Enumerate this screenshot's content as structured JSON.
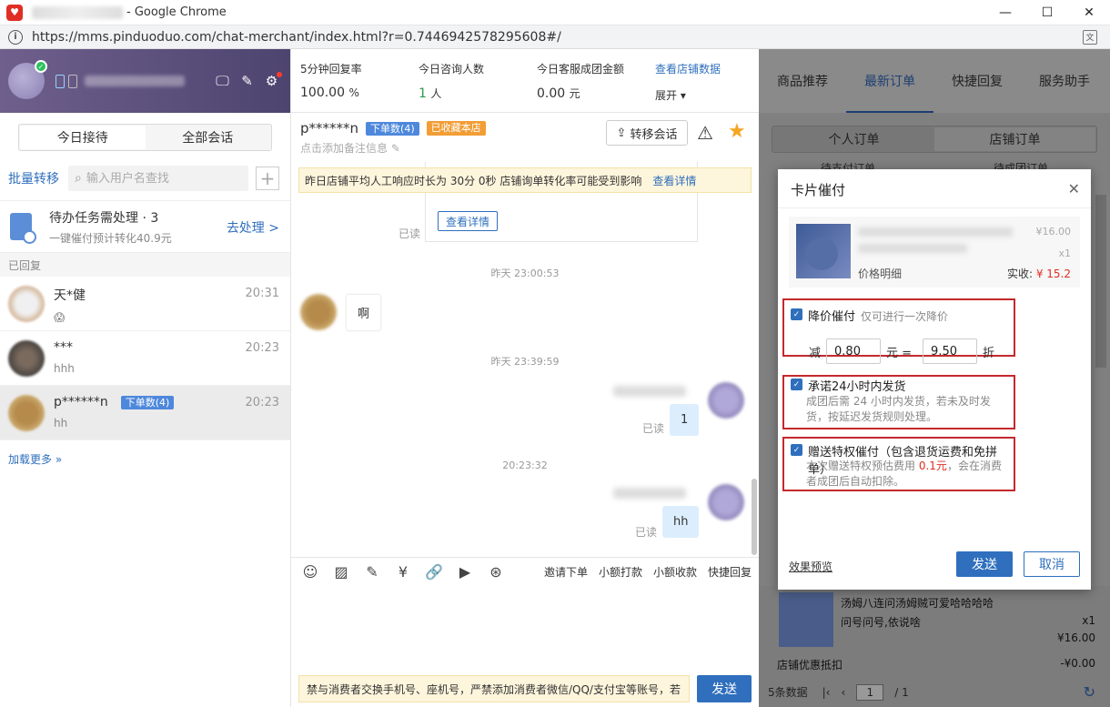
{
  "window": {
    "title": "- Google Chrome",
    "url": "https://mms.pinduoduo.com/chat-merchant/index.html?r=0.7446942578295608#/"
  },
  "sidebar": {
    "tabs": [
      "今日接待",
      "全部会话"
    ],
    "batch_transfer": "批量转移",
    "search_placeholder": "输入用户名查找",
    "todo": {
      "title": "待办任务需处理 · 3",
      "sub": "一键催付预计转化40.9元",
      "action": "去处理 >"
    },
    "section_label": "已回复",
    "conversations": [
      {
        "name": "天*健",
        "sub": "😱",
        "time": "20:31",
        "badge": ""
      },
      {
        "name": "***",
        "sub": "hhh",
        "time": "20:23",
        "badge": ""
      },
      {
        "name": "p******n",
        "sub": "hh",
        "time": "20:23",
        "badge": "下单数(4)"
      }
    ],
    "load_more": "加载更多 »"
  },
  "stats": [
    {
      "label": "5分钟回复率",
      "value": "100.00",
      "unit": "%"
    },
    {
      "label": "今日咨询人数",
      "value": "1",
      "unit": "人"
    },
    {
      "label": "今日客服成团金额",
      "value": "0.00",
      "unit": "元"
    }
  ],
  "stats_links": {
    "view": "查看店铺数据",
    "expand": "展开 ▾"
  },
  "chat": {
    "customer": "p******n",
    "badge_orders": "下单数(4)",
    "badge_fav": "已收藏本店",
    "note": "点击添加备注信息",
    "transfer": "转移会话",
    "notice": "昨日店铺平均人工响应时长为 30分 0秒 店铺询单转化率可能受到影响",
    "notice_link": "查看详情",
    "card_detail": "查看详情",
    "read": "已读",
    "ts1": "昨天 23:00:53",
    "msg1": "啊",
    "ts2": "昨天 23:39:59",
    "msg2": "1",
    "ts3": "20:23:32",
    "msg3": "hh",
    "toolbar_text": [
      "邀请下单",
      "小额打款",
      "小额收款",
      "快捷回复"
    ],
    "input_warning": "禁与消费者交换手机号、座机号，严禁添加消费者微信/QQ/支付宝等账号，若",
    "send": "发送"
  },
  "right": {
    "tabs": [
      "商品推荐",
      "最新订单",
      "快捷回复",
      "服务助手"
    ],
    "subseg": [
      "个人订单",
      "店铺订单"
    ],
    "sub2": [
      "待支付订单",
      "待成团订单"
    ],
    "under": {
      "t1": "汤姆八连问汤姆贼可爱哈哈哈哈",
      "t2": "问号问号,依说啥",
      "qty": "x1",
      "price": "¥16.00",
      "discount_label": "店铺优惠抵扣",
      "discount_value": "-¥0.00"
    },
    "pager": {
      "count": "5条数据",
      "page": "1",
      "total": "/ 1"
    }
  },
  "modal": {
    "title": "卡片催付",
    "product": {
      "detail": "价格明细",
      "price": "¥16.00",
      "qty": "x1",
      "real_label": "实收:",
      "real_value": "¥ 15.2"
    },
    "opt1": {
      "label": "降价催付",
      "hint": "仅可进行一次降价",
      "reduce": "减",
      "amount": "0.80",
      "unit": "元 =",
      "discount": "9.50",
      "zhe": "折"
    },
    "opt2": {
      "label": "承诺24小时内发货",
      "desc": "成团后需 24 小时内发货，若未及时发货，按延迟发货规则处理。"
    },
    "opt3": {
      "label": "赠送特权催付（包含退货运费和免拼单）",
      "desc_pre": "本次赠送特权预估费用",
      "desc_red": "0.1元",
      "desc_post": "，会在消费者成团后自动扣除。"
    },
    "preview": "效果预览",
    "send": "发送",
    "cancel": "取消"
  }
}
